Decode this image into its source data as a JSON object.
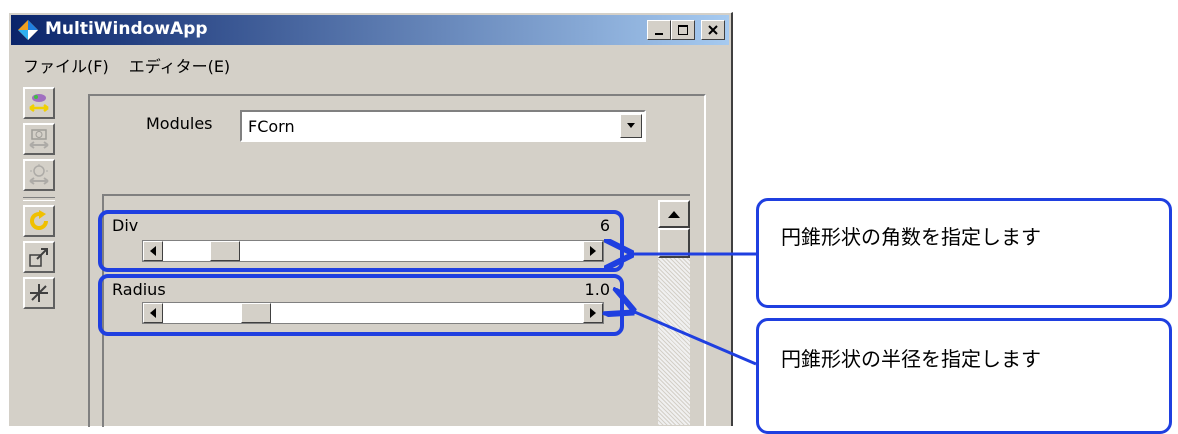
{
  "window": {
    "title": "MultiWindowApp",
    "controls": {
      "minimize": "minimize",
      "maximize": "maximize",
      "close": "close"
    }
  },
  "menu": {
    "items": [
      {
        "label": "ファイル(F)"
      },
      {
        "label": "エディター(E)"
      }
    ]
  },
  "toolbar": {
    "buttons": [
      {
        "icon": "move-model-icon",
        "state": "enabled"
      },
      {
        "icon": "move-camera-icon",
        "state": "disabled"
      },
      {
        "icon": "move-light-icon",
        "state": "disabled"
      },
      {
        "icon": "rotate-icon",
        "state": "enabled"
      },
      {
        "icon": "scale-icon",
        "state": "enabled"
      },
      {
        "icon": "translate-icon",
        "state": "enabled"
      }
    ]
  },
  "modules": {
    "label": "Modules",
    "selected": "FCorn"
  },
  "properties": [
    {
      "label": "Div",
      "value": "6",
      "slider_fraction": 0.12
    },
    {
      "label": "Radius",
      "value": "1.0",
      "slider_fraction": 0.2
    }
  ],
  "callouts": [
    {
      "text": "円錐形状の角数を指定します"
    },
    {
      "text": "円錐形状の半径を指定します"
    }
  ],
  "colors": {
    "highlight": "#1f3fe0",
    "titlebar_start": "#0a246a",
    "titlebar_end": "#a6caf0",
    "face": "#d4d0c8"
  }
}
